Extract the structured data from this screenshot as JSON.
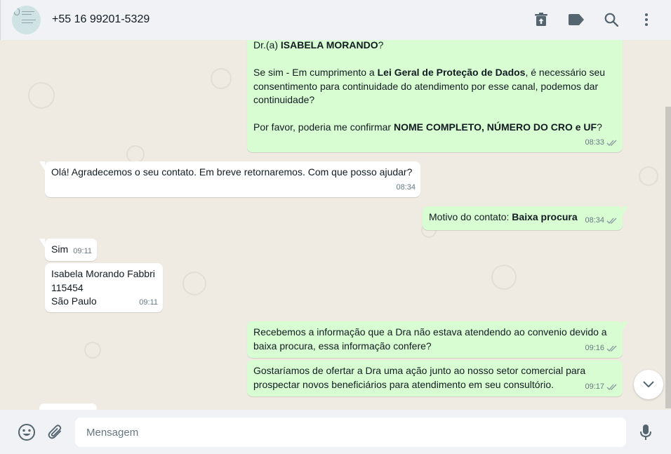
{
  "header": {
    "contact_name": "+55 16 99201-5329",
    "icons": [
      "archive-icon",
      "label-icon",
      "search-icon",
      "menu-icon"
    ]
  },
  "messages": [
    {
      "direction": "outgoing",
      "time": "08:33",
      "read": true,
      "lines": [
        {
          "parts": [
            "Dr.(a) ",
            "ISABELA MORANDO",
            "?"
          ]
        },
        {
          "parts": [
            "Se sim - Em cumprimento a ",
            "Lei Geral de Proteção de Dados",
            ", é necessário seu consentimento para continuidade do atendimento por esse canal, podemos dar continuidade?"
          ]
        },
        {
          "parts": [
            "Por favor, poderia me confirmar ",
            "NOME COMPLETO, NÚMERO DO CRO e UF",
            "?"
          ]
        }
      ]
    },
    {
      "direction": "incoming",
      "time": "08:34",
      "text": "Olá! Agradecemos o seu contato. Em breve retornaremos. Com que posso ajudar?"
    },
    {
      "direction": "outgoing",
      "time": "08:34",
      "read": true,
      "parts": [
        "Motivo do contato: ",
        "Baixa procura"
      ]
    },
    {
      "direction": "incoming",
      "time": "09:11",
      "text": "Sim"
    },
    {
      "direction": "incoming",
      "time": "09:11",
      "lines": [
        "Isabela Morando Fabbri",
        "115454",
        "São Paulo"
      ]
    },
    {
      "direction": "outgoing",
      "time": "09:16",
      "read": true,
      "text": "Recebemos a informação que a Dra não estava atendendo ao convenio devido a baixa procura, essa informação confere?"
    },
    {
      "direction": "outgoing",
      "time": "09:17",
      "read": true,
      "text": "Gostaríamos de ofertar a Dra uma ação junto ao nosso setor comercial para prospectar novos beneficiários para atendimento em seu consultório."
    }
  ],
  "footer": {
    "placeholder": "Mensagem",
    "icons": [
      "emoji-icon",
      "attach-icon",
      "mic-icon"
    ]
  },
  "colors": {
    "outgoing_bubble": "#d9fdd3",
    "incoming_bubble": "#ffffff",
    "chat_background": "#efeae2",
    "header_background": "#f0f2f5",
    "read_ticks": "#8696a0"
  }
}
